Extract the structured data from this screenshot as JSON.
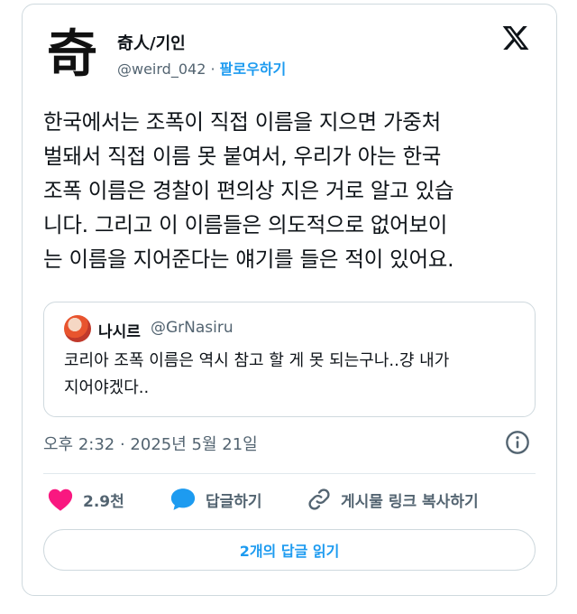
{
  "author": {
    "avatar_glyph": "奇",
    "display_name": "奇人/기인",
    "handle": "@weird_042",
    "separator": "·",
    "follow_label": "팔로우하기"
  },
  "tweet": {
    "text": "한국에서는 조폭이 직접 이름을 지으면 가중처\n벌돼서 직접 이름 못 붙여서, 우리가 아는 한국\n조폭 이름은 경찰이 편의상 지은 거로 알고 있습\n니다. 그리고 이 이름들은 의도적으로 없어보이\n는 이름을 지어준다는 얘기를 들은 적이 있어요."
  },
  "quote": {
    "name": "나시르",
    "handle": "@GrNasiru",
    "text": "코리아 조폭 이름은 역시 참고 할 게 못 되는구나..걍 내가\n지어야겠다.."
  },
  "meta": {
    "timestamp": "오후 2:32 · 2025년 5월 21일"
  },
  "actions": {
    "like_count": "2.9천",
    "reply_label": "답글하기",
    "copy_link_label": "게시물 링크 복사하기"
  },
  "read_replies_label": "2개의 답글 읽기",
  "colors": {
    "accent": "#1d9bf0",
    "like": "#f91880",
    "muted": "#536471",
    "text": "#0f1419",
    "border": "#cfd9de"
  },
  "icons": {
    "brand": "x-logo-icon",
    "info": "info-icon",
    "like": "heart-icon",
    "reply": "speech-bubble-icon",
    "copy": "link-icon"
  }
}
